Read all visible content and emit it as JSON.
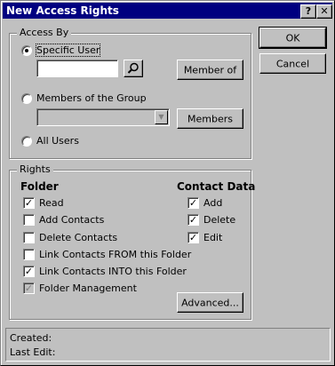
{
  "window": {
    "title": "New Access Rights",
    "help_glyph": "?",
    "close_glyph": "✕"
  },
  "buttons": {
    "ok": "OK",
    "cancel": "Cancel",
    "member_of": "Member of",
    "members": "Members",
    "advanced": "Advanced..."
  },
  "access_by": {
    "legend": "Access By",
    "specific_user": "Specific User",
    "members_of_group": "Members of the Group",
    "all_users": "All Users",
    "selected": "specific_user",
    "user_value": "",
    "group_value": ""
  },
  "rights": {
    "legend": "Rights",
    "folder_heading": "Folder",
    "contact_heading": "Contact Data",
    "folder_items": [
      {
        "label": "Read",
        "checked": true
      },
      {
        "label": "Add Contacts",
        "checked": false
      },
      {
        "label": "Delete Contacts",
        "checked": false
      },
      {
        "label": "Link Contacts FROM this Folder",
        "checked": false
      },
      {
        "label": "Link Contacts INTO this Folder",
        "checked": true
      },
      {
        "label": "Folder Management",
        "checked": true,
        "disabled": true
      }
    ],
    "contact_items": [
      {
        "label": "Add",
        "checked": true
      },
      {
        "label": "Delete",
        "checked": true
      },
      {
        "label": "Edit",
        "checked": true
      }
    ]
  },
  "status": {
    "created_label": "Created:",
    "last_edit_label": "Last Edit:"
  },
  "icons": {
    "search": "search-icon",
    "dropdown": "chevron-down-icon"
  },
  "colors": {
    "titlebar": "#000080",
    "face": "#c0c0c0"
  }
}
